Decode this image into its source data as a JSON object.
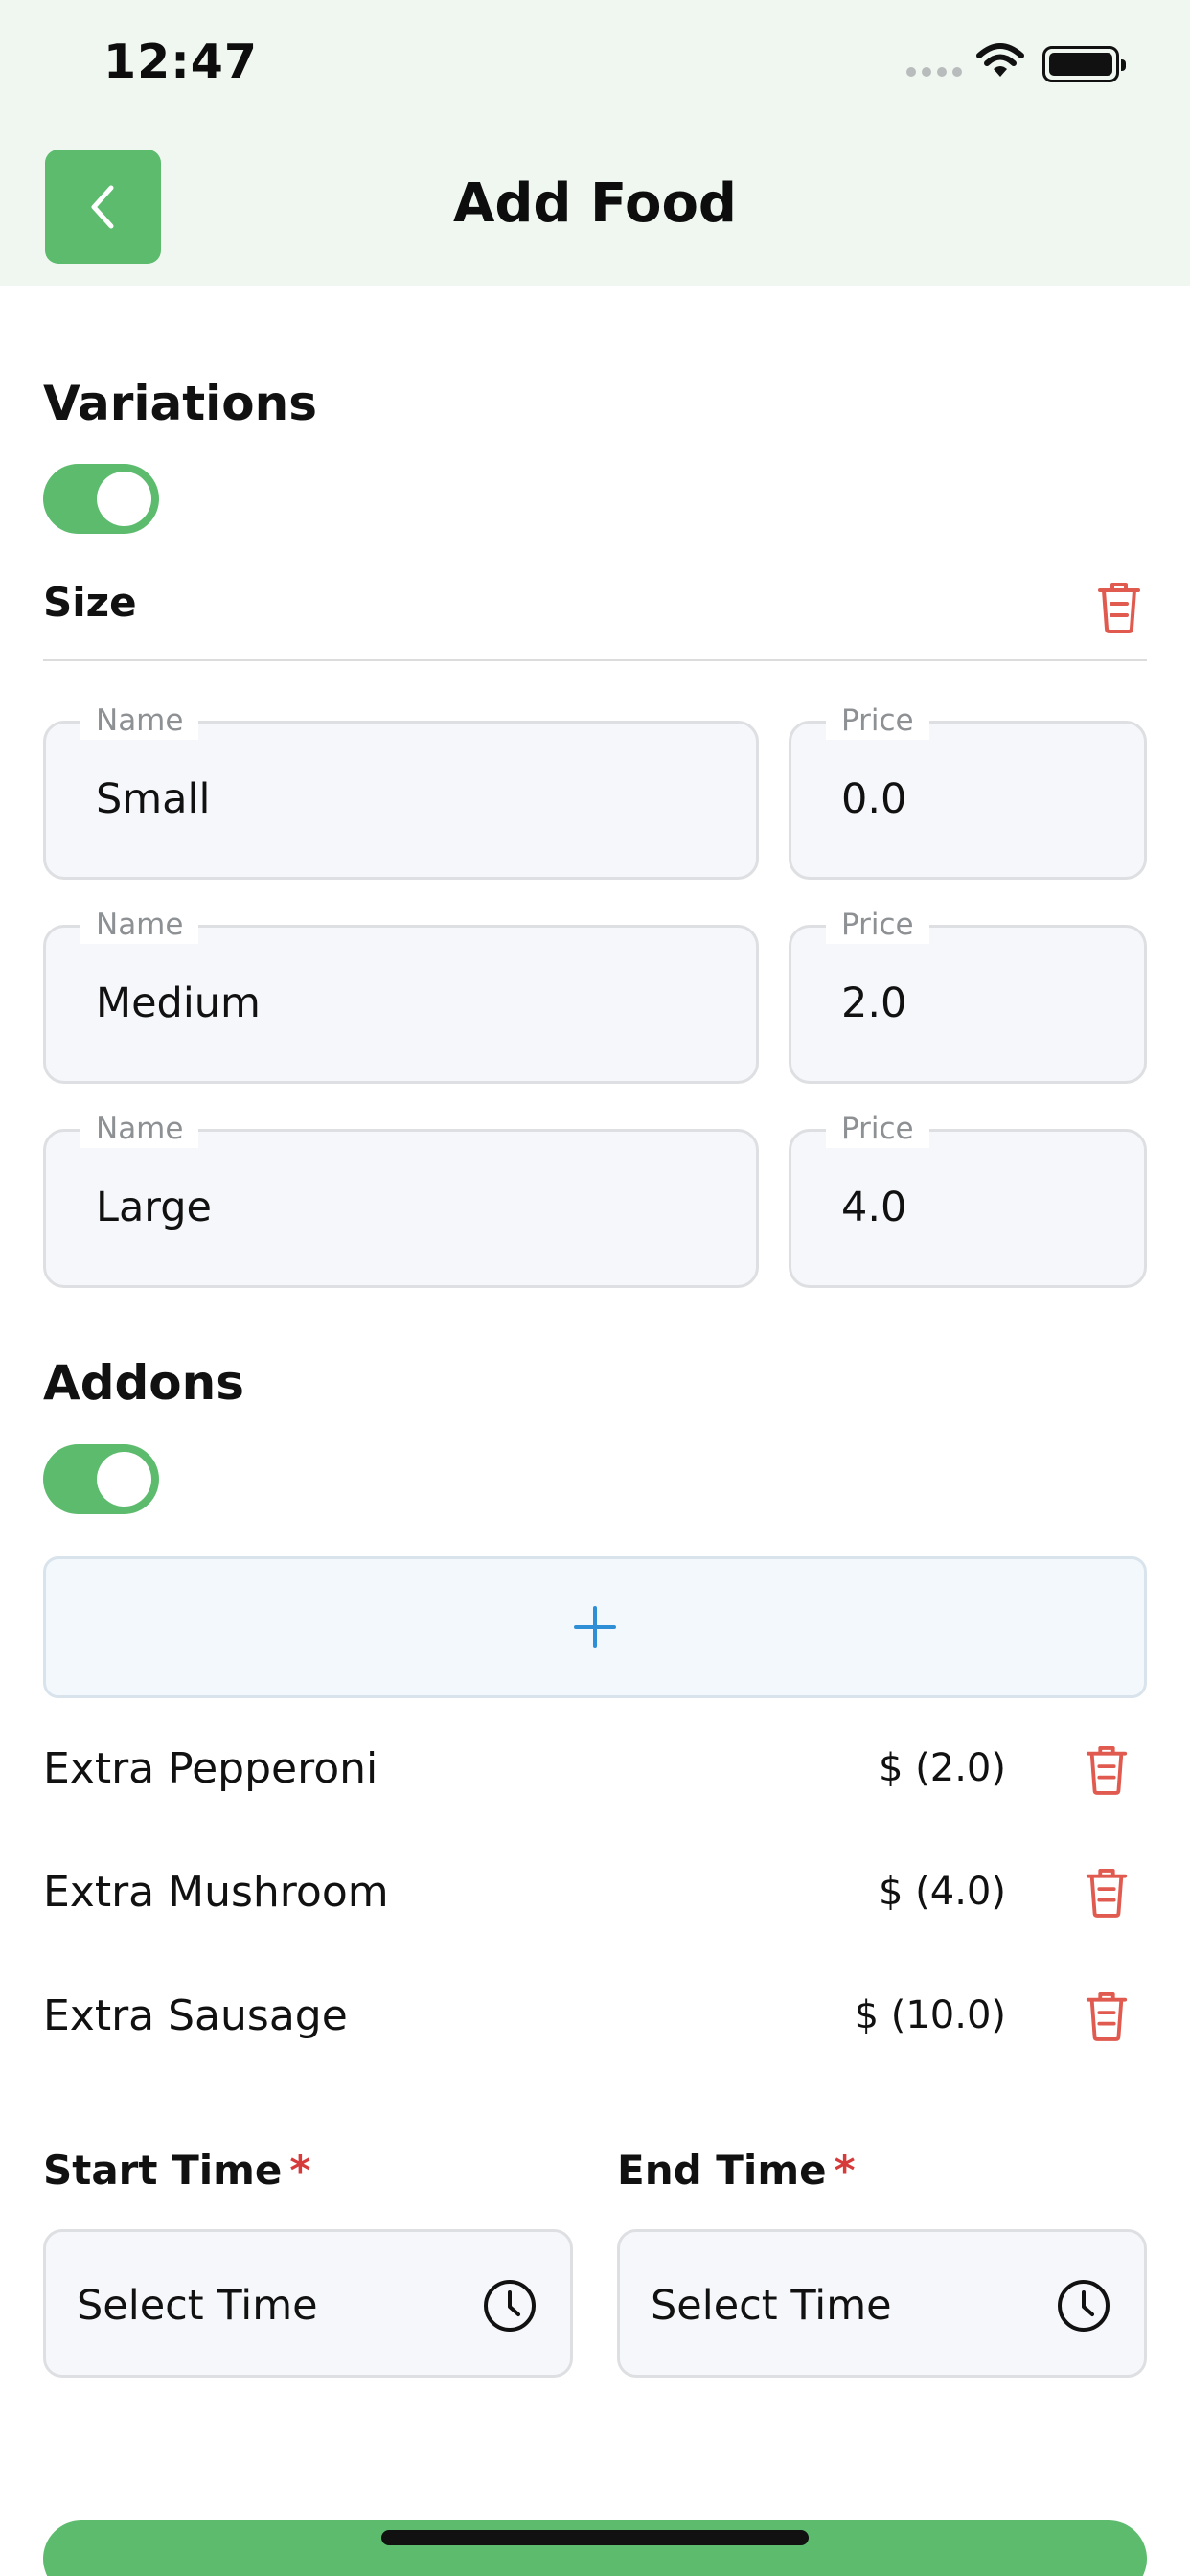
{
  "status_bar": {
    "time": "12:47"
  },
  "header": {
    "title": "Add Food",
    "back_icon": "chevron-left-icon"
  },
  "variations": {
    "title": "Variations",
    "enabled": true,
    "group_name": "Size",
    "name_label": "Name",
    "price_label": "Price",
    "rows": [
      {
        "name": "Small",
        "price": "0.0"
      },
      {
        "name": "Medium",
        "price": "2.0"
      },
      {
        "name": "Large",
        "price": "4.0"
      }
    ]
  },
  "addons": {
    "title": "Addons",
    "enabled": true,
    "add_icon": "plus-icon",
    "items": [
      {
        "name": "Extra Pepperoni",
        "price": "$ (2.0)"
      },
      {
        "name": "Extra Mushroom",
        "price": "$ (4.0)"
      },
      {
        "name": "Extra Sausage",
        "price": "$ (10.0)"
      }
    ]
  },
  "schedule": {
    "start_label": "Start Time",
    "end_label": "End Time",
    "required_mark": "*",
    "start_placeholder": "Select Time",
    "end_placeholder": "Select Time"
  },
  "colors": {
    "accent": "#5cbb6c",
    "header_bg": "#f0f7f1",
    "delete": "#e05a4f",
    "plus": "#2e8fd6"
  }
}
